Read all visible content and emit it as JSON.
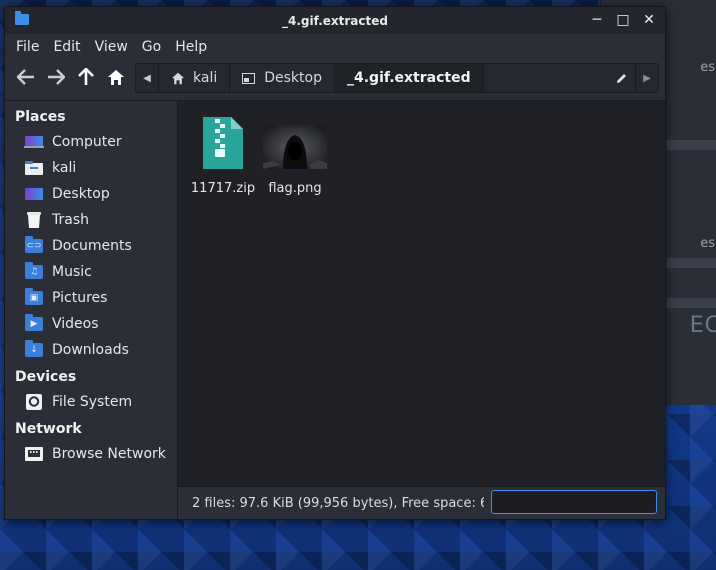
{
  "background_window": {
    "text_1": "es",
    "text_2": "es",
    "big_text": "EC"
  },
  "window": {
    "title": "_4.gif.extracted",
    "controls": {
      "minimize": "─",
      "maximize": "□",
      "close": "✕"
    }
  },
  "menu": [
    "File",
    "Edit",
    "View",
    "Go",
    "Help"
  ],
  "toolbar": {
    "back_icon": "arrow-left-icon",
    "forward_icon": "arrow-right-icon",
    "up_icon": "arrow-up-icon",
    "home_icon": "home-icon"
  },
  "pathbar": {
    "segments": [
      {
        "label": "kali",
        "icon": "home-icon"
      },
      {
        "label": "Desktop",
        "icon": "desktop-icon"
      },
      {
        "label": "_4.gif.extracted",
        "icon": ""
      }
    ]
  },
  "sidebar": {
    "places_header": "Places",
    "places": [
      {
        "label": "Computer",
        "icon": "computer-icon"
      },
      {
        "label": "kali",
        "icon": "home-folder-icon"
      },
      {
        "label": "Desktop",
        "icon": "desktop-icon"
      },
      {
        "label": "Trash",
        "icon": "trash-icon"
      },
      {
        "label": "Documents",
        "icon": "documents-folder-icon"
      },
      {
        "label": "Music",
        "icon": "music-folder-icon"
      },
      {
        "label": "Pictures",
        "icon": "pictures-folder-icon"
      },
      {
        "label": "Videos",
        "icon": "videos-folder-icon"
      },
      {
        "label": "Downloads",
        "icon": "downloads-folder-icon"
      }
    ],
    "devices_header": "Devices",
    "devices": [
      {
        "label": "File System",
        "icon": "drive-icon"
      }
    ],
    "network_header": "Network",
    "network": [
      {
        "label": "Browse Network",
        "icon": "network-icon"
      }
    ]
  },
  "files": [
    {
      "name": "11717.zip",
      "icon": "zip-archive-icon"
    },
    {
      "name": "flag.png",
      "icon": "image-thumbnail"
    }
  ],
  "status": {
    "text": "2 files: 97.6 KiB (99,956 bytes), Free space: 6",
    "filter_value": ""
  },
  "colors": {
    "accent": "#3c8ee6",
    "folder": "#3b7fd9",
    "window_bg": "#2b2e36",
    "content_bg": "#1f2126",
    "zip_icon": "#2aa59a"
  }
}
